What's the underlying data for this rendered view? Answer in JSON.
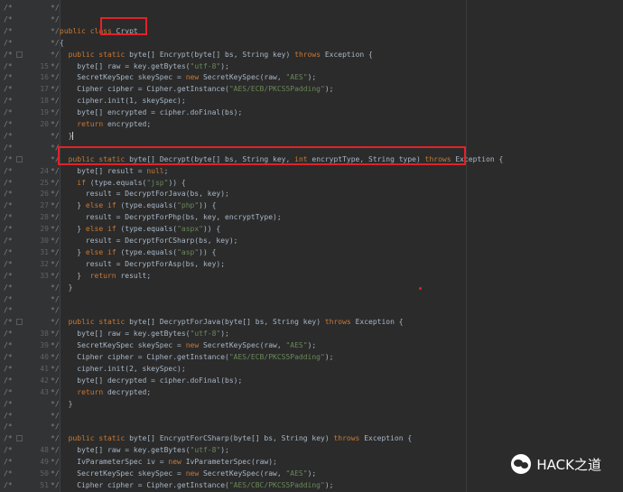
{
  "editor": {
    "comment_prefix": "/*",
    "comment_suffix": "*/",
    "lines": [
      {
        "num": "",
        "code": ""
      },
      {
        "num": "",
        "code": ""
      },
      {
        "num": "",
        "code": "public class Crypt"
      },
      {
        "num": "",
        "code": "{"
      },
      {
        "num": "",
        "code": "  public static byte[] Encrypt(byte[] bs, String key) throws Exception {"
      },
      {
        "num": "15",
        "code": "    byte[] raw = key.getBytes(\"utf-8\");"
      },
      {
        "num": "16",
        "code": "    SecretKeySpec skeySpec = new SecretKeySpec(raw, \"AES\");"
      },
      {
        "num": "17",
        "code": "    Cipher cipher = Cipher.getInstance(\"AES/ECB/PKCS5Padding\");"
      },
      {
        "num": "18",
        "code": "    cipher.init(1, skeySpec);"
      },
      {
        "num": "19",
        "code": "    byte[] encrypted = cipher.doFinal(bs);"
      },
      {
        "num": "20",
        "code": "    return encrypted;"
      },
      {
        "num": "",
        "code": "  }"
      },
      {
        "num": "",
        "code": ""
      },
      {
        "num": "",
        "code": "  public static byte[] Decrypt(byte[] bs, String key, int encryptType, String type) throws Exception {"
      },
      {
        "num": "24",
        "code": "    byte[] result = null;"
      },
      {
        "num": "25",
        "code": "    if (type.equals(\"jsp\")) {"
      },
      {
        "num": "26",
        "code": "      result = DecryptForJava(bs, key);"
      },
      {
        "num": "27",
        "code": "    } else if (type.equals(\"php\")) {"
      },
      {
        "num": "28",
        "code": "      result = DecryptForPhp(bs, key, encryptType);"
      },
      {
        "num": "29",
        "code": "    } else if (type.equals(\"aspx\")) {"
      },
      {
        "num": "30",
        "code": "      result = DecryptForCSharp(bs, key);"
      },
      {
        "num": "31",
        "code": "    } else if (type.equals(\"asp\")) {"
      },
      {
        "num": "32",
        "code": "      result = DecryptForAsp(bs, key);"
      },
      {
        "num": "33",
        "code": "    }  return result;"
      },
      {
        "num": "",
        "code": "  }"
      },
      {
        "num": "",
        "code": ""
      },
      {
        "num": "",
        "code": ""
      },
      {
        "num": "",
        "code": "  public static byte[] DecryptForJava(byte[] bs, String key) throws Exception {"
      },
      {
        "num": "38",
        "code": "    byte[] raw = key.getBytes(\"utf-8\");"
      },
      {
        "num": "39",
        "code": "    SecretKeySpec skeySpec = new SecretKeySpec(raw, \"AES\");"
      },
      {
        "num": "40",
        "code": "    Cipher cipher = Cipher.getInstance(\"AES/ECB/PKCS5Padding\");"
      },
      {
        "num": "41",
        "code": "    cipher.init(2, skeySpec);"
      },
      {
        "num": "42",
        "code": "    byte[] decrypted = cipher.doFinal(bs);"
      },
      {
        "num": "43",
        "code": "    return decrypted;"
      },
      {
        "num": "",
        "code": "  }"
      },
      {
        "num": "",
        "code": ""
      },
      {
        "num": "",
        "code": ""
      },
      {
        "num": "",
        "code": "  public static byte[] EncryptForCSharp(byte[] bs, String key) throws Exception {"
      },
      {
        "num": "48",
        "code": "    byte[] raw = key.getBytes(\"utf-8\");"
      },
      {
        "num": "49",
        "code": "    IvParameterSpec iv = new IvParameterSpec(raw);"
      },
      {
        "num": "50",
        "code": "    SecretKeySpec skeySpec = new SecretKeySpec(raw, \"AES\");"
      },
      {
        "num": "51",
        "code": "    Cipher cipher = Cipher.getInstance(\"AES/CBC/PKCS5Padding\");"
      }
    ]
  },
  "watermark": {
    "text": "HACK之道",
    "icon": "wechat-icon"
  },
  "colors": {
    "background": "#2b2b2b",
    "keyword": "#cc7832",
    "string": "#6a8759",
    "highlight": "#e0232a"
  }
}
